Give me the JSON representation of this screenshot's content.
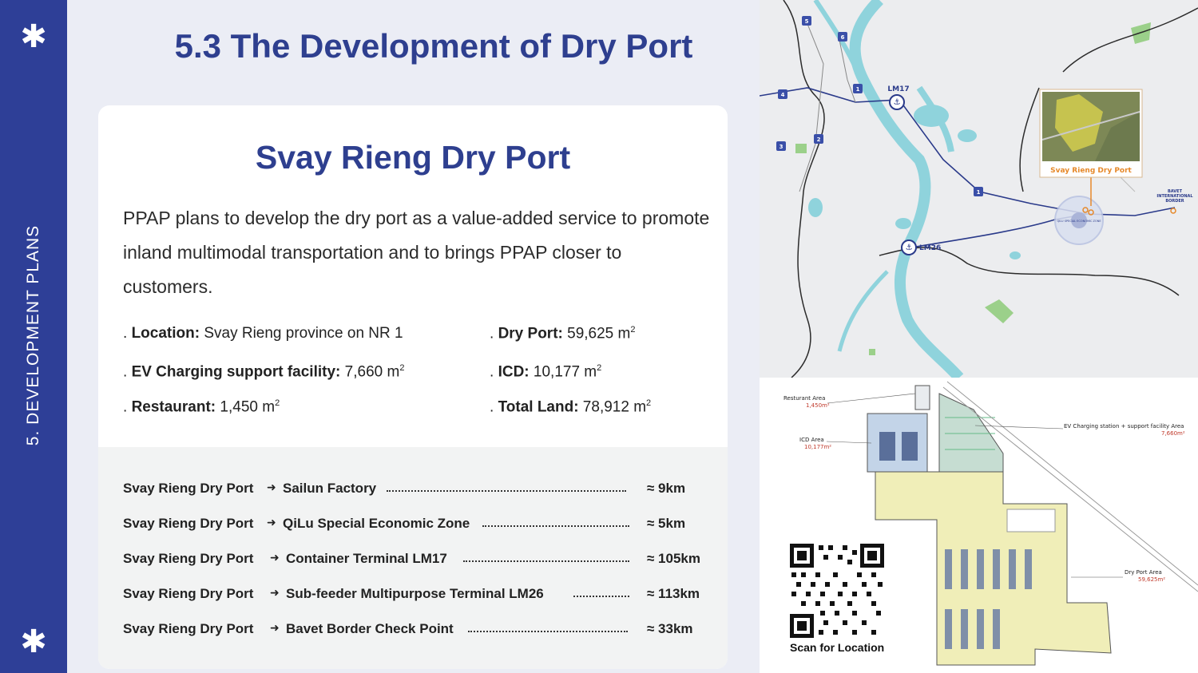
{
  "sidebar": {
    "label": "5. DEVELOPMENT PLANS",
    "icon_top": "asterisk-icon",
    "icon_bottom": "asterisk-icon",
    "color": "#2e3f97"
  },
  "page_title": "5.3 The Development of Dry Port",
  "card": {
    "title": "Svay Rieng Dry Port",
    "description": "PPAP plans to develop the dry port as a value-added service to promote inland multimodal transportation and to brings PPAP closer to customers.",
    "facts": [
      {
        "prefix": ". ",
        "label": "Location:",
        "value": " Svay Rieng province on NR 1",
        "unit": ""
      },
      {
        "prefix": ". ",
        "label": "Dry Port:",
        "value": " 59,625 m",
        "unit": "2"
      },
      {
        "prefix": ". ",
        "label": "EV Charging support facility:",
        "value": " 7,660 m",
        "unit": "2"
      },
      {
        "prefix": ". ",
        "label": "ICD:",
        "value": " 10,177 m",
        "unit": "2"
      },
      {
        "prefix": ". ",
        "label": "Restaurant:",
        "value": " 1,450 m",
        "unit": "2"
      },
      {
        "prefix": ". ",
        "label": "Total Land:",
        "value": " 78,912 m",
        "unit": "2"
      }
    ]
  },
  "routes": [
    {
      "from": "Svay Rieng Dry Port",
      "arrow": "➜",
      "to": "Sailun Factory",
      "distance": "≈ 9km"
    },
    {
      "from": "Svay Rieng Dry Port",
      "arrow": "➜",
      "to": "QiLu Special Economic Zone",
      "distance": "≈ 5km"
    },
    {
      "from": "Svay Rieng Dry Port",
      "arrow": "➜",
      "to": "Container Terminal LM17",
      "distance": "≈ 105km"
    },
    {
      "from": "Svay Rieng Dry Port",
      "arrow": "➜",
      "to": "Sub-feeder Multipurpose Terminal LM26",
      "distance": "≈ 113km"
    },
    {
      "from": "Svay Rieng Dry Port",
      "arrow": "➜",
      "to": "Bavet Border Check Point",
      "distance": "≈ 33km"
    }
  ],
  "map": {
    "labels": {
      "lm17": "LM17",
      "lm26": "LM26",
      "dry_port": "Svay Rieng Dry Port",
      "bavet_1": "BAVET",
      "bavet_2": "INTERNATIONAL",
      "bavet_3": "BORDER",
      "qilu": "QILU SPECIAL ECONOMIC ZONE"
    },
    "road_shields": [
      "5",
      "6",
      "4",
      "1",
      "3",
      "2",
      "1"
    ],
    "colors": {
      "water": "#8fd3dc",
      "road": "#2a3a8a",
      "border": "#2b2b2b",
      "land": "#ecedef",
      "park": "#9bd08a",
      "pin": "#e6892a"
    }
  },
  "site_plan": {
    "labels": [
      {
        "name": "Resturant Area",
        "area": "1,450m²"
      },
      {
        "name": "ICD Area",
        "area": "10,177m²"
      },
      {
        "name": "EV Charging station + support facility Area",
        "area": "7,660m²"
      },
      {
        "name": "Dry Port Area",
        "area": "59,625m²"
      }
    ],
    "qr_caption": "Scan for Location"
  }
}
